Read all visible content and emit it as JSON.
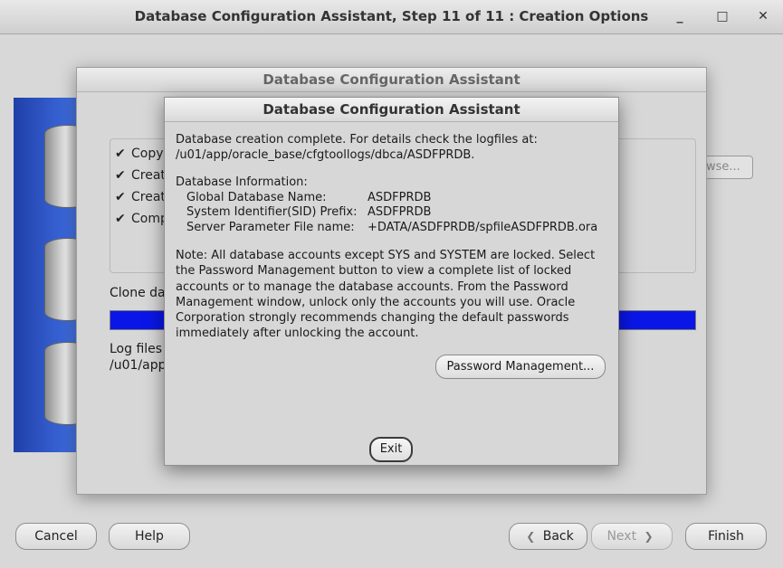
{
  "main_window": {
    "title": "Database Configuration Assistant, Step 11 of 11 : Creation Options",
    "controls": {
      "minimize": "_",
      "maximize": "□",
      "close": "✕"
    },
    "browse_label": "owse...",
    "nav": {
      "cancel": "Cancel",
      "help": "Help",
      "back": "Back",
      "next": "Next",
      "finish": "Finish"
    }
  },
  "progress_dialog": {
    "title": "Database Configuration Assistant",
    "steps": [
      "Copyi",
      "Creati",
      "Creati",
      "Comp"
    ],
    "check_glyph": "✔",
    "clone_label": "Clone dat",
    "progress_fraction": 1.0,
    "log_label": "Log files f",
    "log_path": "/u01/app"
  },
  "complete_dialog": {
    "title": "Database Configuration Assistant",
    "message_line1": "Database creation complete. For details check the logfiles at:",
    "message_line2": " /u01/app/oracle_base/cfgtoollogs/dbca/ASDFPRDB.",
    "info_heading": "Database Information:",
    "info": [
      {
        "label": "Global Database Name:",
        "value": "ASDFPRDB"
      },
      {
        "label": "System Identifier(SID) Prefix:",
        "value": "ASDFPRDB"
      },
      {
        "label": "Server Parameter File name:",
        "value": "+DATA/ASDFPRDB/spfileASDFPRDB.ora"
      }
    ],
    "note_lines": [
      "Note: All database accounts except SYS and SYSTEM are locked. Select",
      "the Password Management button to view a complete list of locked",
      "accounts or to manage the database accounts. From the Password",
      "Management window, unlock only the accounts you will use. Oracle",
      "Corporation strongly recommends changing the default passwords",
      "immediately after unlocking the account."
    ],
    "password_button": "Password Management...",
    "exit_button": "Exit"
  },
  "colors": {
    "progress_fill": "#0a16e8",
    "banner": "#2a4fc0"
  }
}
